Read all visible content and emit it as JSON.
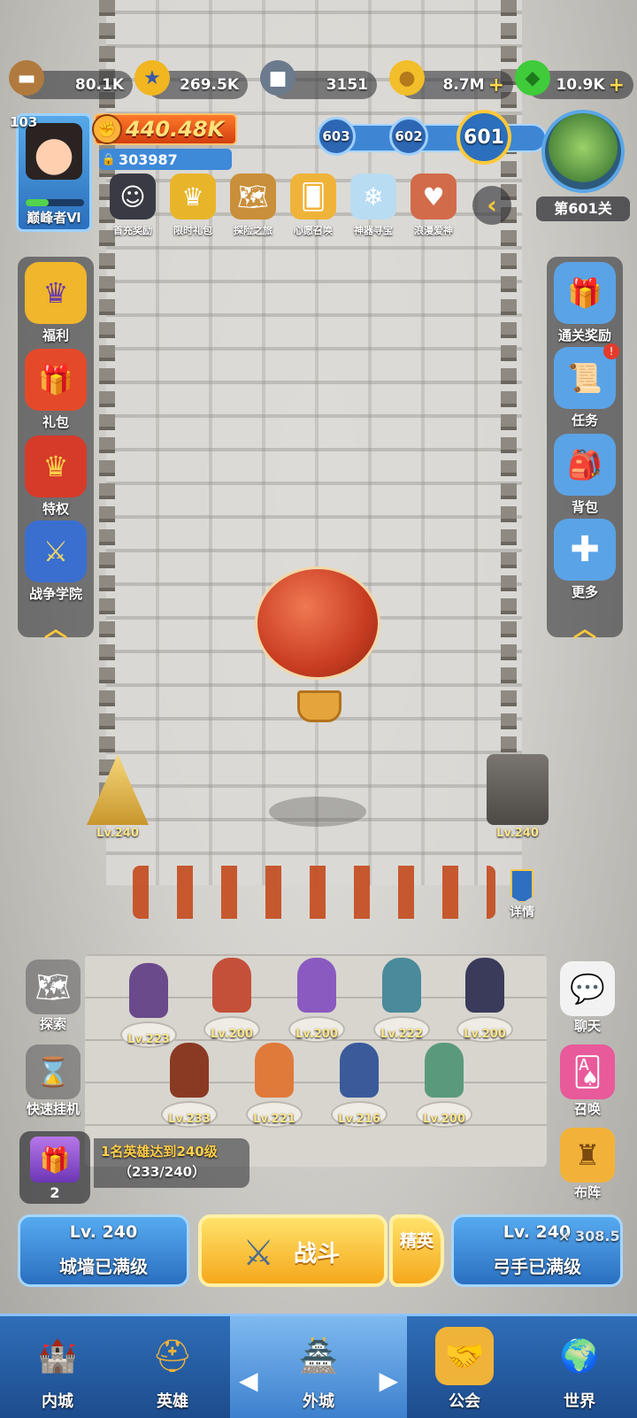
{
  "resources": {
    "wood": "80.1K",
    "stars": "269.5K",
    "stone": "3151",
    "gold": "8.7M",
    "gems": "10.9K"
  },
  "player": {
    "level": "103",
    "rank": "巅峰者Ⅵ",
    "power": "440.48K",
    "id": "303987"
  },
  "stage": {
    "prev2": "603",
    "prev1": "602",
    "current": "601",
    "map_label": "第601关"
  },
  "events": [
    {
      "label": "首充奖励",
      "icon": "hero-girl-icon"
    },
    {
      "label": "限时礼包",
      "icon": "crown-chest-icon"
    },
    {
      "label": "探险之旅",
      "icon": "scroll-map-icon"
    },
    {
      "label": "心愿召唤",
      "icon": "wish-card-icon"
    },
    {
      "label": "神器寻宝",
      "icon": "crystal-artifact-icon"
    },
    {
      "label": "浪漫爱神",
      "icon": "cupid-icon"
    }
  ],
  "left_menu": [
    {
      "label": "福利",
      "icon": "crown-shield-icon"
    },
    {
      "label": "礼包",
      "icon": "gift-box-icon"
    },
    {
      "label": "特权",
      "icon": "privilege-crown-icon"
    },
    {
      "label": "战争学院",
      "icon": "crossed-swords-icon"
    }
  ],
  "right_menu": [
    {
      "label": "通关奖励",
      "icon": "reward-chest-icon"
    },
    {
      "label": "任务",
      "icon": "scroll-icon",
      "badge": "!"
    },
    {
      "label": "背包",
      "icon": "backpack-icon"
    },
    {
      "label": "更多",
      "icon": "plus-icon"
    }
  ],
  "towers": {
    "left_lv": "Lv.240",
    "right_lv": "Lv.240"
  },
  "detail_label": "详情",
  "heroes": [
    {
      "lv": "Lv.223",
      "color": "#6a4a8a"
    },
    {
      "lv": "Lv.200",
      "color": "#c4503a"
    },
    {
      "lv": "Lv.200",
      "color": "#8a5ac0"
    },
    {
      "lv": "Lv.222",
      "color": "#4a8a9a"
    },
    {
      "lv": "Lv.200",
      "color": "#3a3a5a"
    },
    {
      "lv": "Lv.233",
      "color": "#8a3a22"
    },
    {
      "lv": "Lv.221",
      "color": "#e07a3a"
    },
    {
      "lv": "Lv.216",
      "color": "#3a5a9a"
    },
    {
      "lv": "Lv.200",
      "color": "#5a9a7a"
    }
  ],
  "left_tools": [
    {
      "label": "探索",
      "icon": "explore-map-icon"
    },
    {
      "label": "快速挂机",
      "icon": "hourglass-icon"
    }
  ],
  "right_tools": [
    {
      "label": "聊天",
      "icon": "chat-bubble-icon"
    },
    {
      "label": "召唤",
      "icon": "summon-cards-icon"
    },
    {
      "label": "布阵",
      "icon": "chess-rook-icon"
    }
  ],
  "quest": {
    "title": "1名英雄达到240级",
    "progress": "（233/240）",
    "gift_count": "2"
  },
  "actions": {
    "wall_lv": "Lv. 240",
    "wall_status": "城墙已满级",
    "battle": "战斗",
    "elite": "精英",
    "archer_lv": "Lv. 240",
    "archer_extra": "× 308.5",
    "archer_status": "弓手已满级"
  },
  "nav": [
    {
      "label": "内城",
      "icon": "castle-icon"
    },
    {
      "label": "英雄",
      "icon": "knight-helmet-icon"
    },
    {
      "label": "外城",
      "icon": "outer-castle-icon",
      "active": true
    },
    {
      "label": "公会",
      "icon": "handshake-icon"
    },
    {
      "label": "世界",
      "icon": "globe-icon"
    }
  ]
}
